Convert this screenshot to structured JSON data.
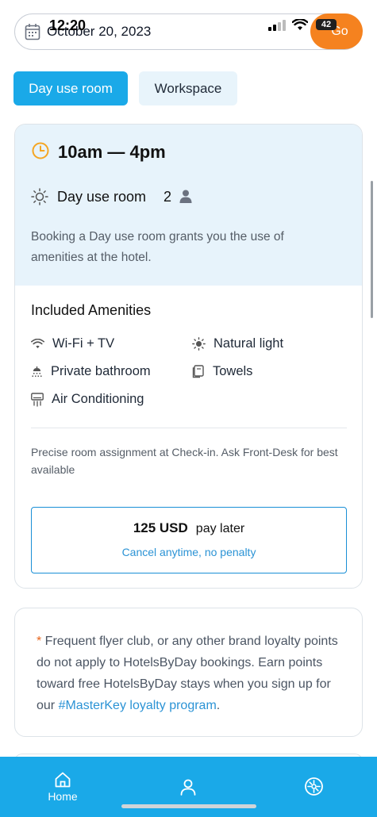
{
  "status_bar": {
    "time": "12:20",
    "battery": "42"
  },
  "search_bar": {
    "date": "October 20, 2023",
    "go_label": "Go"
  },
  "tabs": [
    {
      "label": "Day use room",
      "active": true
    },
    {
      "label": "Workspace",
      "active": false
    }
  ],
  "room": {
    "hours": "10am — 4pm",
    "type": "Day use room",
    "guests": "2",
    "description": "Booking a Day use room grants you the use of amenities at the hotel."
  },
  "amenities": {
    "title": "Included Amenities",
    "items": [
      {
        "label": "Wi-Fi + TV",
        "icon": "wifi-icon"
      },
      {
        "label": "Natural light",
        "icon": "sun-icon"
      },
      {
        "label": "Private bathroom",
        "icon": "shower-icon"
      },
      {
        "label": "Towels",
        "icon": "towel-icon"
      },
      {
        "label": "Air Conditioning",
        "icon": "ac-icon"
      }
    ]
  },
  "assignment_note": "Precise room assignment at Check-in. Ask Front-Desk for best available",
  "price": {
    "amount": "125 USD",
    "mode": "pay later",
    "cancel_note": "Cancel anytime, no penalty"
  },
  "loyalty": {
    "star": "*",
    "text": " Frequent flyer club, or any other brand loyalty points do not apply to HotelsByDay bookings. Earn points toward free HotelsByDay stays when you sign up for our ",
    "link": "#MasterKey loyalty program",
    "end": "."
  },
  "bottom_nav": {
    "home_label": "Home"
  },
  "colors": {
    "accent": "#1aa9e8",
    "orange": "#f5821f",
    "card_bg": "#e7f3fb"
  }
}
